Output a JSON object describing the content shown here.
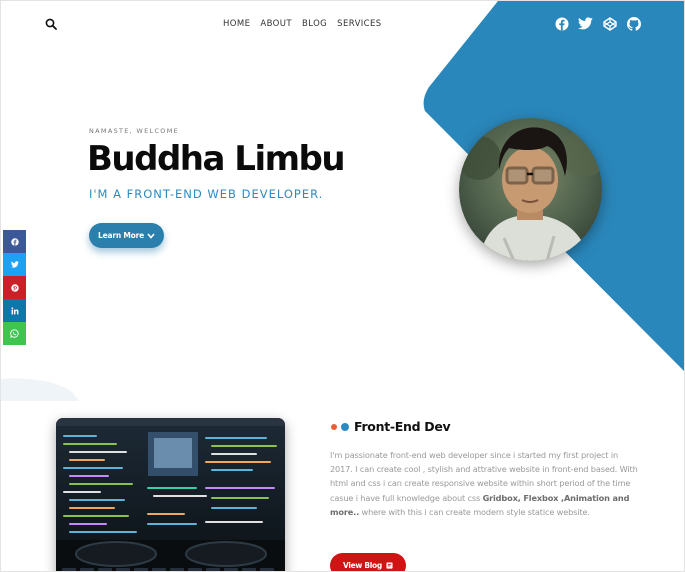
{
  "header": {
    "search_icon": "search-icon",
    "nav": [
      "HOME",
      "ABOUT",
      "BLOG",
      "SERVICES"
    ],
    "socials": [
      "facebook-icon",
      "twitter-icon",
      "codepen-icon",
      "github-icon"
    ]
  },
  "hero": {
    "greeting": "NAMASTE, WELCOME",
    "name": "Buddha Limbu",
    "role": "I'M A FRONT-END WEB DEVELOPER.",
    "cta_label": "Learn More"
  },
  "share_bar": [
    {
      "icon": "facebook-icon",
      "color": "#3b5998"
    },
    {
      "icon": "twitter-icon",
      "color": "#1da1f2"
    },
    {
      "icon": "pinterest-icon",
      "color": "#cb2027"
    },
    {
      "icon": "linkedin-icon",
      "color": "#0e76a8"
    },
    {
      "icon": "whatsapp-icon",
      "color": "#3ec44f"
    }
  ],
  "about": {
    "title": "Front-End Dev",
    "desc_1": "I'm passionate front-end web developer since i started my first project in 2017. I can create cool , stylish and attrative website in front-end based. With html and css i can create responsive website within short period of the time casue i have full knowledge about css ",
    "desc_bold": "Gridbox, Flexbox ,Animation and more..",
    "desc_2": " where with this i can create modern style statice website.",
    "cta_label": "View Blog"
  },
  "colors": {
    "accent_blue": "#2b8ac0",
    "shape_blue": "#2a87bb",
    "red": "#d01414",
    "dot_orange": "#e8603a",
    "dot_blue": "#2b8ac0"
  }
}
